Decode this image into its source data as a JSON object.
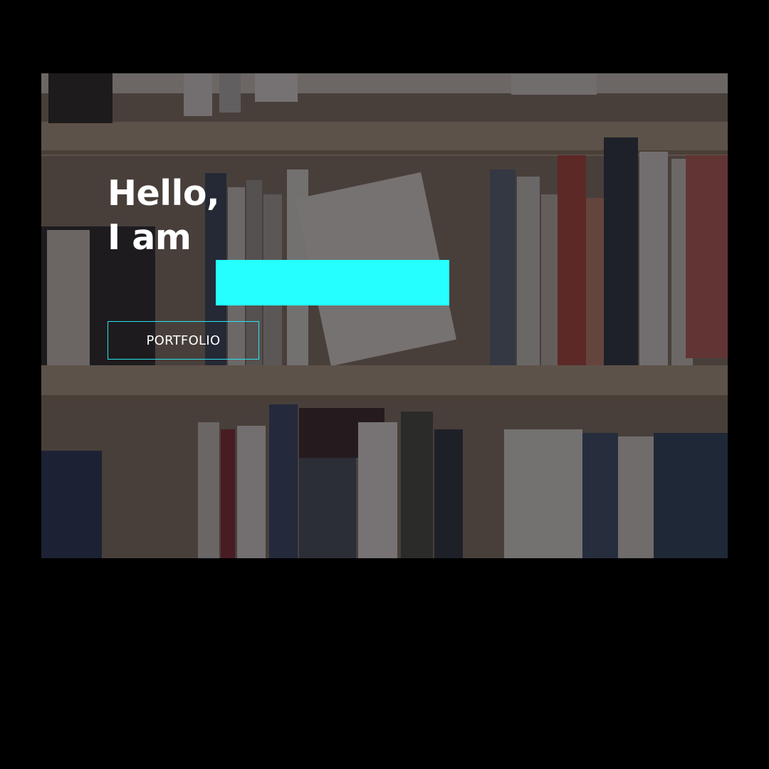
{
  "hero": {
    "greeting_line1": "Hello,",
    "greeting_line2": "I am",
    "name_highlight_color": "#26ffff",
    "portfolio_button_label": "PORTFOLIO",
    "button_border_color": "#26e6f0",
    "background_image": "bookshelf-photo"
  }
}
